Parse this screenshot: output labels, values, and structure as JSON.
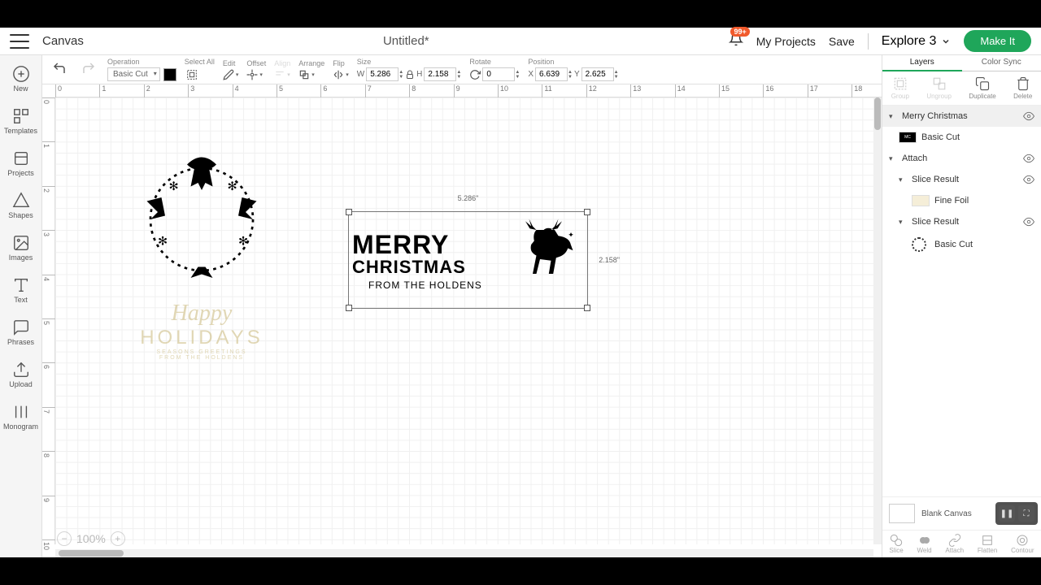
{
  "topbar": {
    "app_name": "Canvas",
    "title": "Untitled*",
    "notification_badge": "99+",
    "my_projects": "My Projects",
    "save": "Save",
    "machine": "Explore 3",
    "make_it": "Make It"
  },
  "left_nav": {
    "new": "New",
    "templates": "Templates",
    "projects": "Projects",
    "shapes": "Shapes",
    "images": "Images",
    "text": "Text",
    "phrases": "Phrases",
    "upload": "Upload",
    "monogram": "Monogram"
  },
  "toolbar": {
    "operation_label": "Operation",
    "operation_value": "Basic Cut",
    "select_all": "Select All",
    "edit": "Edit",
    "offset": "Offset",
    "align": "Align",
    "arrange": "Arrange",
    "flip": "Flip",
    "size": "Size",
    "w_label": "W",
    "w_value": "5.286",
    "h_label": "H",
    "h_value": "2.158",
    "rotate_label": "Rotate",
    "rotate_value": "0",
    "position_label": "Position",
    "x_label": "X",
    "x_value": "6.639",
    "y_label": "Y",
    "y_value": "2.625"
  },
  "canvas": {
    "selection_w": "5.286\"",
    "selection_h": "2.158\"",
    "merry_line1": "MERRY",
    "merry_line2": "CHRISTMAS",
    "merry_line3": "FROM THE HOLDENS",
    "holidays_script": "Happy",
    "holidays_caps": "HOLIDAYS",
    "holidays_sub1": "SEASONS GREETINGS",
    "holidays_sub2": "FROM THE HOLDENS",
    "zoom": "100%"
  },
  "right_panel": {
    "tab_layers": "Layers",
    "tab_colorsync": "Color Sync",
    "action_group": "Group",
    "action_ungroup": "Ungroup",
    "action_duplicate": "Duplicate",
    "action_delete": "Delete",
    "layers": {
      "merry_christmas": "Merry Christmas",
      "basic_cut": "Basic Cut",
      "attach": "Attach",
      "slice_result": "Slice Result",
      "fine_foil": "Fine Foil"
    },
    "blank_canvas": "Blank Canvas",
    "bottom": {
      "slice": "Slice",
      "weld": "Weld",
      "attach": "Attach",
      "flatten": "Flatten",
      "contour": "Contour"
    }
  }
}
